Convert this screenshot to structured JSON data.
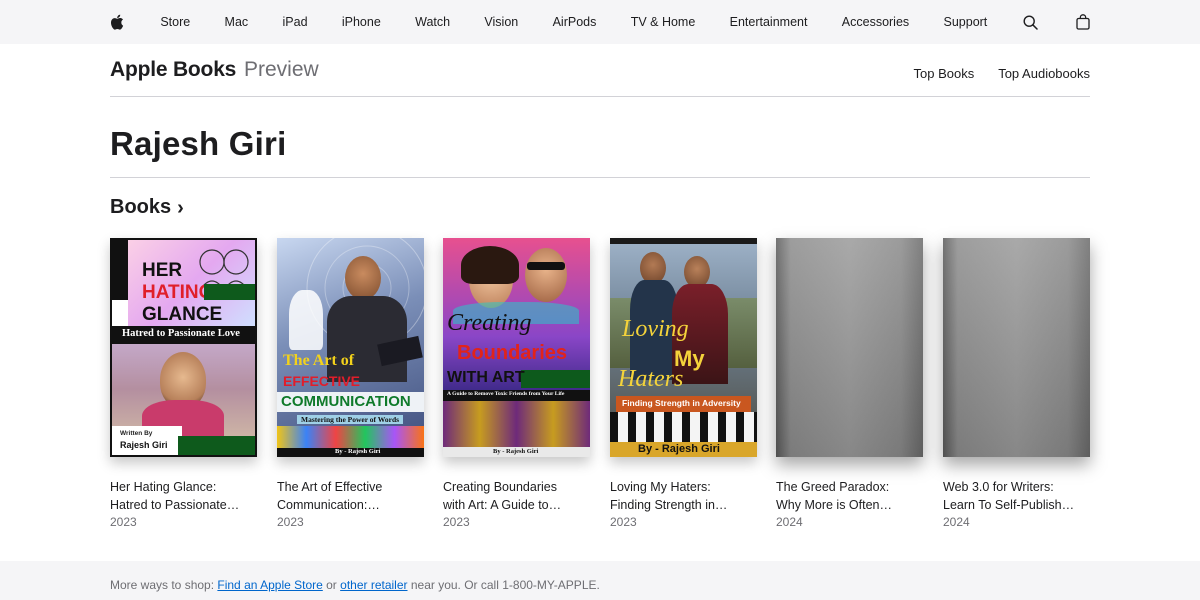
{
  "globalnav": {
    "items": [
      "Store",
      "Mac",
      "iPad",
      "iPhone",
      "Watch",
      "Vision",
      "AirPods",
      "TV & Home",
      "Entertainment",
      "Accessories",
      "Support"
    ]
  },
  "localnav": {
    "brand_main": "Apple Books",
    "brand_sub": "Preview",
    "links": [
      "Top Books",
      "Top Audiobooks"
    ]
  },
  "artist": {
    "name": "Rajesh Giri"
  },
  "section": {
    "title": "Books",
    "chevron": "›"
  },
  "books": [
    {
      "title_lines": [
        "Her Hating Glance:",
        "Hatred to Passionate…"
      ],
      "year": "2023",
      "cover": {
        "l1": "HER",
        "l2": "HATING",
        "l3": "GLANCE",
        "sub": "Hatred to Passionate Love",
        "by": "Written By",
        "author": "Rajesh Giri"
      }
    },
    {
      "title_lines": [
        "The Art of Effective",
        "Communication:…"
      ],
      "year": "2023",
      "cover": {
        "l1": "The Art of",
        "l2": "EFFECTIVE",
        "l3": "COMMUNICATION",
        "sub": "Mastering the Power of Words",
        "author": "By - Rajesh Giri"
      }
    },
    {
      "title_lines": [
        "Creating Boundaries",
        "with Art: A Guide to…"
      ],
      "year": "2023",
      "cover": {
        "l1": "Creating",
        "l2": "Boundaries",
        "l3": "WITH ART",
        "sub": "A Guide to Remove Toxic Friends from Your Life",
        "author": "By - Rajesh Giri"
      }
    },
    {
      "title_lines": [
        "Loving My Haters:",
        "Finding Strength in…"
      ],
      "year": "2023",
      "cover": {
        "l1": "Loving",
        "l2": "My",
        "l3": "Haters",
        "sub": "Finding Strength in Adversity",
        "author": "By - Rajesh Giri"
      }
    },
    {
      "title_lines": [
        "The Greed Paradox:",
        "Why More is Often…"
      ],
      "year": "2024",
      "cover": null
    },
    {
      "title_lines": [
        "Web 3.0 for Writers:",
        "Learn To Self-Publish…"
      ],
      "year": "2024",
      "cover": null
    }
  ],
  "footer": {
    "prefix": "More ways to shop: ",
    "link1": "Find an Apple Store",
    "middle": " or ",
    "link2": "other retailer",
    "suffix": " near you. Or call 1-800-MY-APPLE."
  },
  "icons": {
    "apple": "apple-logo-icon",
    "search": "search-icon",
    "bag": "bag-icon"
  }
}
